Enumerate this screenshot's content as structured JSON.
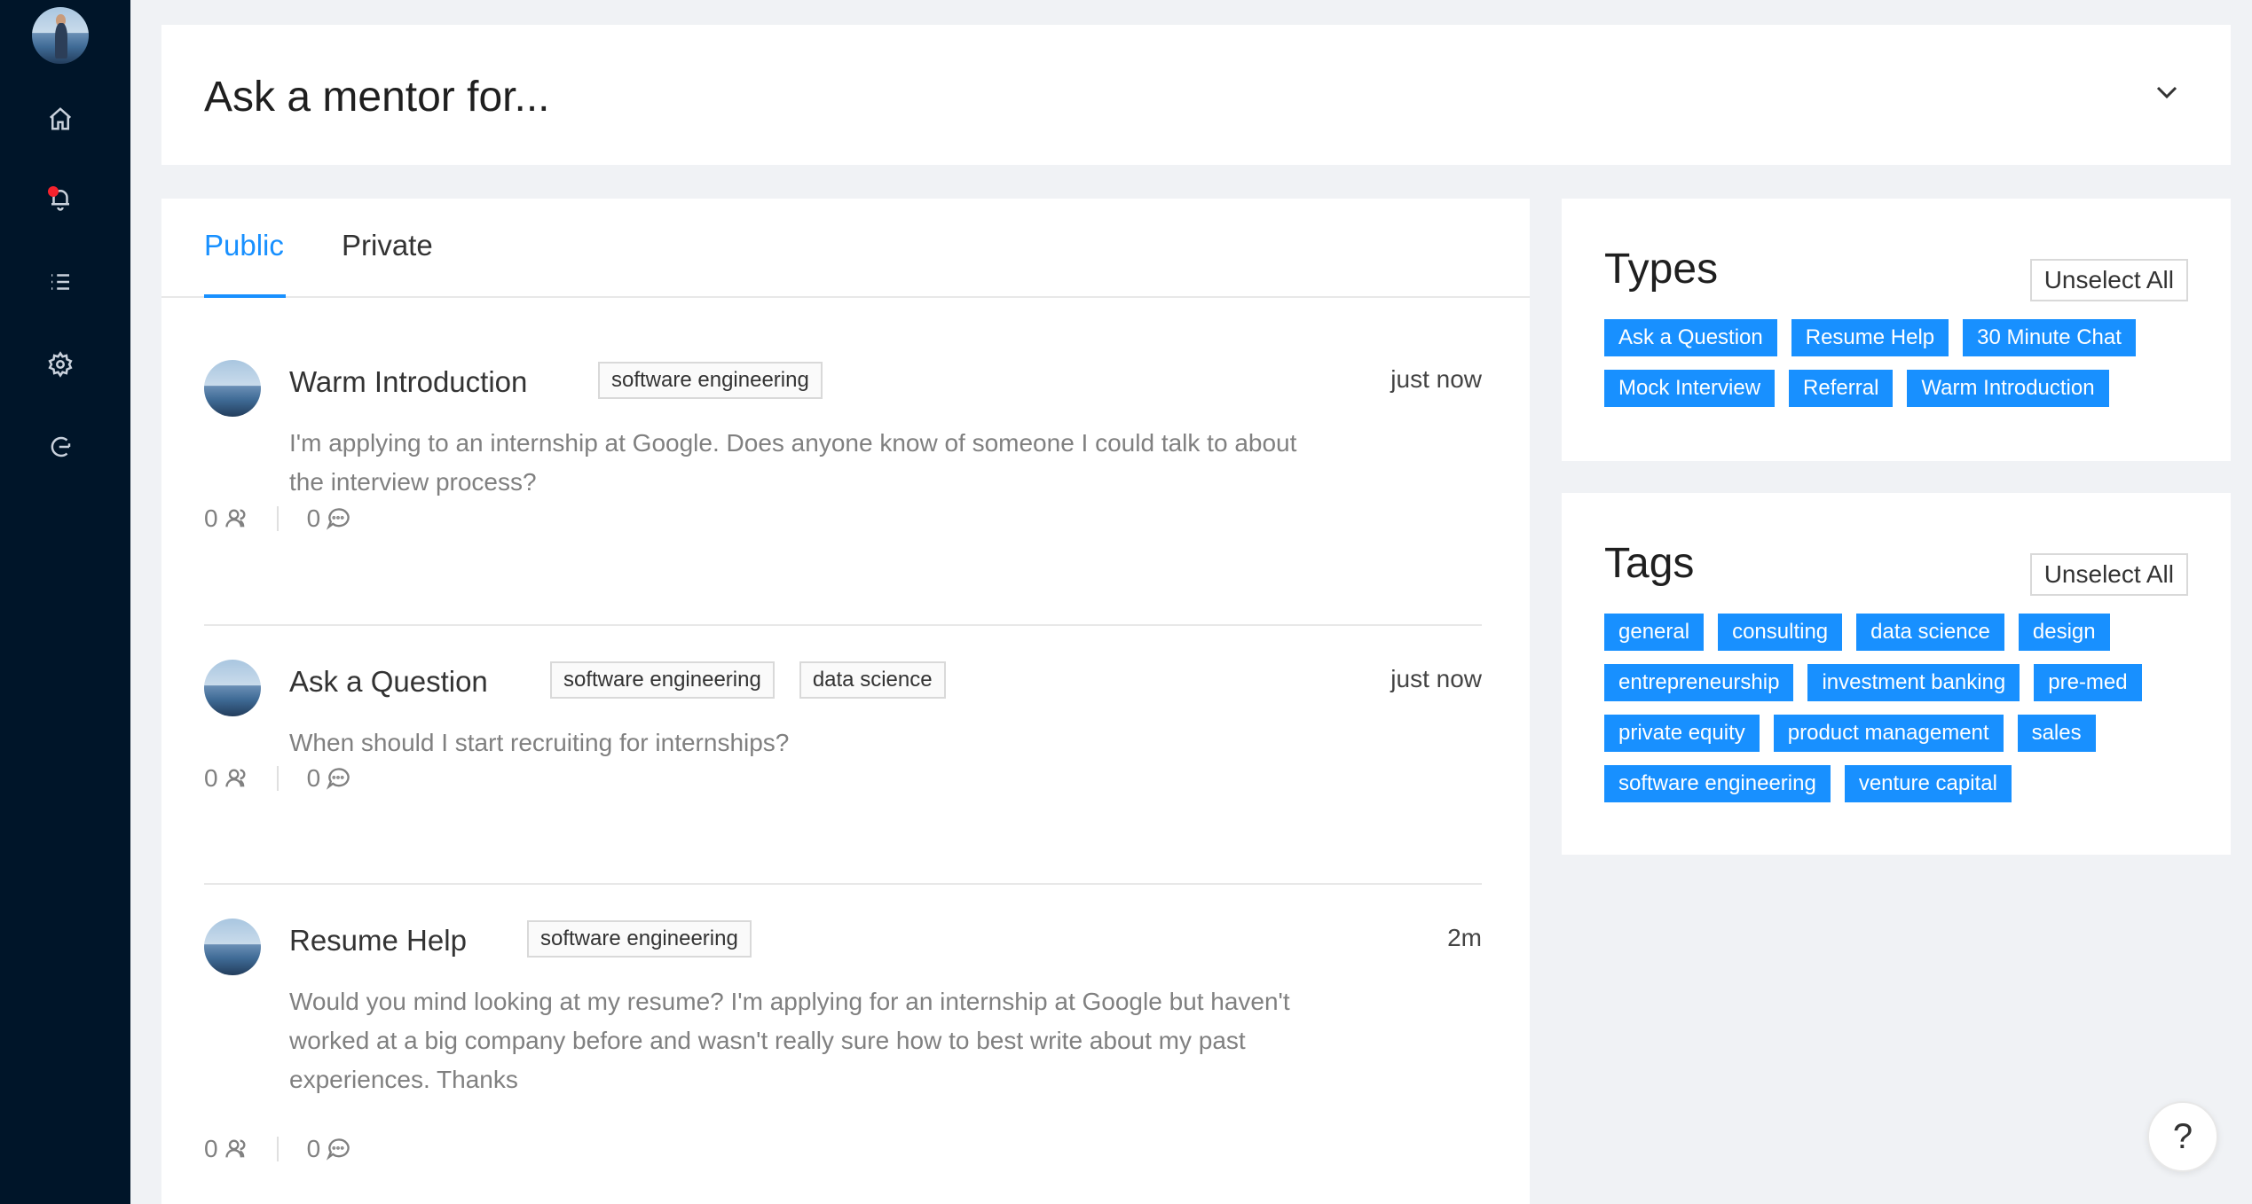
{
  "header": {
    "title": "Ask a mentor for..."
  },
  "tabs": [
    {
      "label": "Public"
    },
    {
      "label": "Private"
    }
  ],
  "posts": [
    {
      "title": "Warm Introduction",
      "tags": [
        "software engineering"
      ],
      "time": "just now",
      "body": "I'm applying to an internship at Google. Does anyone know of someone I could talk to about the interview process?",
      "people_count": "0",
      "comment_count": "0"
    },
    {
      "title": "Ask a Question",
      "tags": [
        "software engineering",
        "data science"
      ],
      "time": "just now",
      "body": "When should I start recruiting for internships?",
      "people_count": "0",
      "comment_count": "0"
    },
    {
      "title": "Resume Help",
      "tags": [
        "software engineering"
      ],
      "time": "2m",
      "body": "Would you mind looking at my resume? I'm applying for an internship at Google but haven't worked at a big company before and wasn't really sure how to best write about my past experiences. Thanks",
      "people_count": "0",
      "comment_count": "0"
    }
  ],
  "types": {
    "title": "Types",
    "unselect_label": "Unselect All",
    "items": [
      "Ask a Question",
      "Resume Help",
      "30 Minute Chat",
      "Mock Interview",
      "Referral",
      "Warm Introduction"
    ]
  },
  "tags": {
    "title": "Tags",
    "unselect_label": "Unselect All",
    "items": [
      "general",
      "consulting",
      "data science",
      "design",
      "entrepreneurship",
      "investment banking",
      "pre-med",
      "private equity",
      "product management",
      "sales",
      "software engineering",
      "venture capital"
    ]
  },
  "help": {
    "label": "?"
  },
  "colors": {
    "accent": "#1890ff",
    "sidebar": "#001529",
    "notification": "#f5222d"
  },
  "sidebar_icons": [
    "home-icon",
    "bell-icon",
    "list-icon",
    "gear-icon",
    "logout-icon"
  ]
}
